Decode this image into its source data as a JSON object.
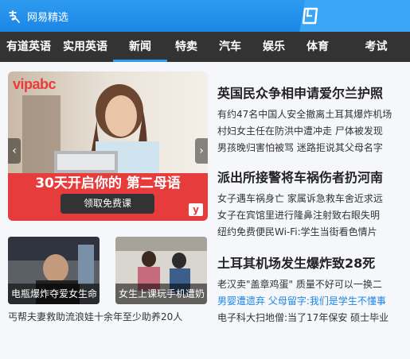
{
  "app": {
    "brand": "网易精选"
  },
  "nav": {
    "items": [
      {
        "label": "有道英语"
      },
      {
        "label": "实用英语"
      },
      {
        "label": "新闻"
      },
      {
        "label": "特卖"
      },
      {
        "label": "汽车"
      },
      {
        "label": "娱乐"
      },
      {
        "label": "体育"
      },
      {
        "label": "考试"
      }
    ]
  },
  "banner": {
    "brand": "vipabc",
    "slogan": "30天开启你的 第二母语",
    "cta": "领取免费课",
    "mark": "y"
  },
  "thumbs": [
    {
      "caption": "电瓶爆炸夺爱女生命"
    },
    {
      "caption": "女生上课玩手机遭奶"
    }
  ],
  "bottom_caption": "丐帮夫妻救助流浪娃十余年至少助养20人",
  "news": [
    {
      "title": "英国民众争相申请爱尔兰护照",
      "lines": [
        "有约47名中国人安全撤离土耳其爆炸机场",
        "村妇女主任在防洪中遭冲走 尸体被发现",
        "男孩晚归害怕被骂 迷路拒说其父母名字"
      ]
    },
    {
      "title": "派出所接警将车祸伤者扔河南",
      "lines": [
        "女子遇车祸身亡 家属诉急救车舍近求远",
        "女子在宾馆里进行隆鼻注射致右眼失明",
        "纽约免费便民Wi-Fi:学生当街看色情片"
      ]
    },
    {
      "title": "土耳其机场发生爆炸致28死",
      "lines": [
        "老汉卖\"盖章鸡蛋\" 质量不好可以一换二"
      ],
      "line2_blue1": "男婴遭遗弃",
      "line2_blue2": "父母留字:我们是学生不懂事",
      "line3": "电子科大扫地僧:当了17年保安 硕士毕业"
    }
  ],
  "colors": {
    "accent": "#1b86e6",
    "nav_bg": "#333333",
    "banner_red": "#e73c3c"
  }
}
